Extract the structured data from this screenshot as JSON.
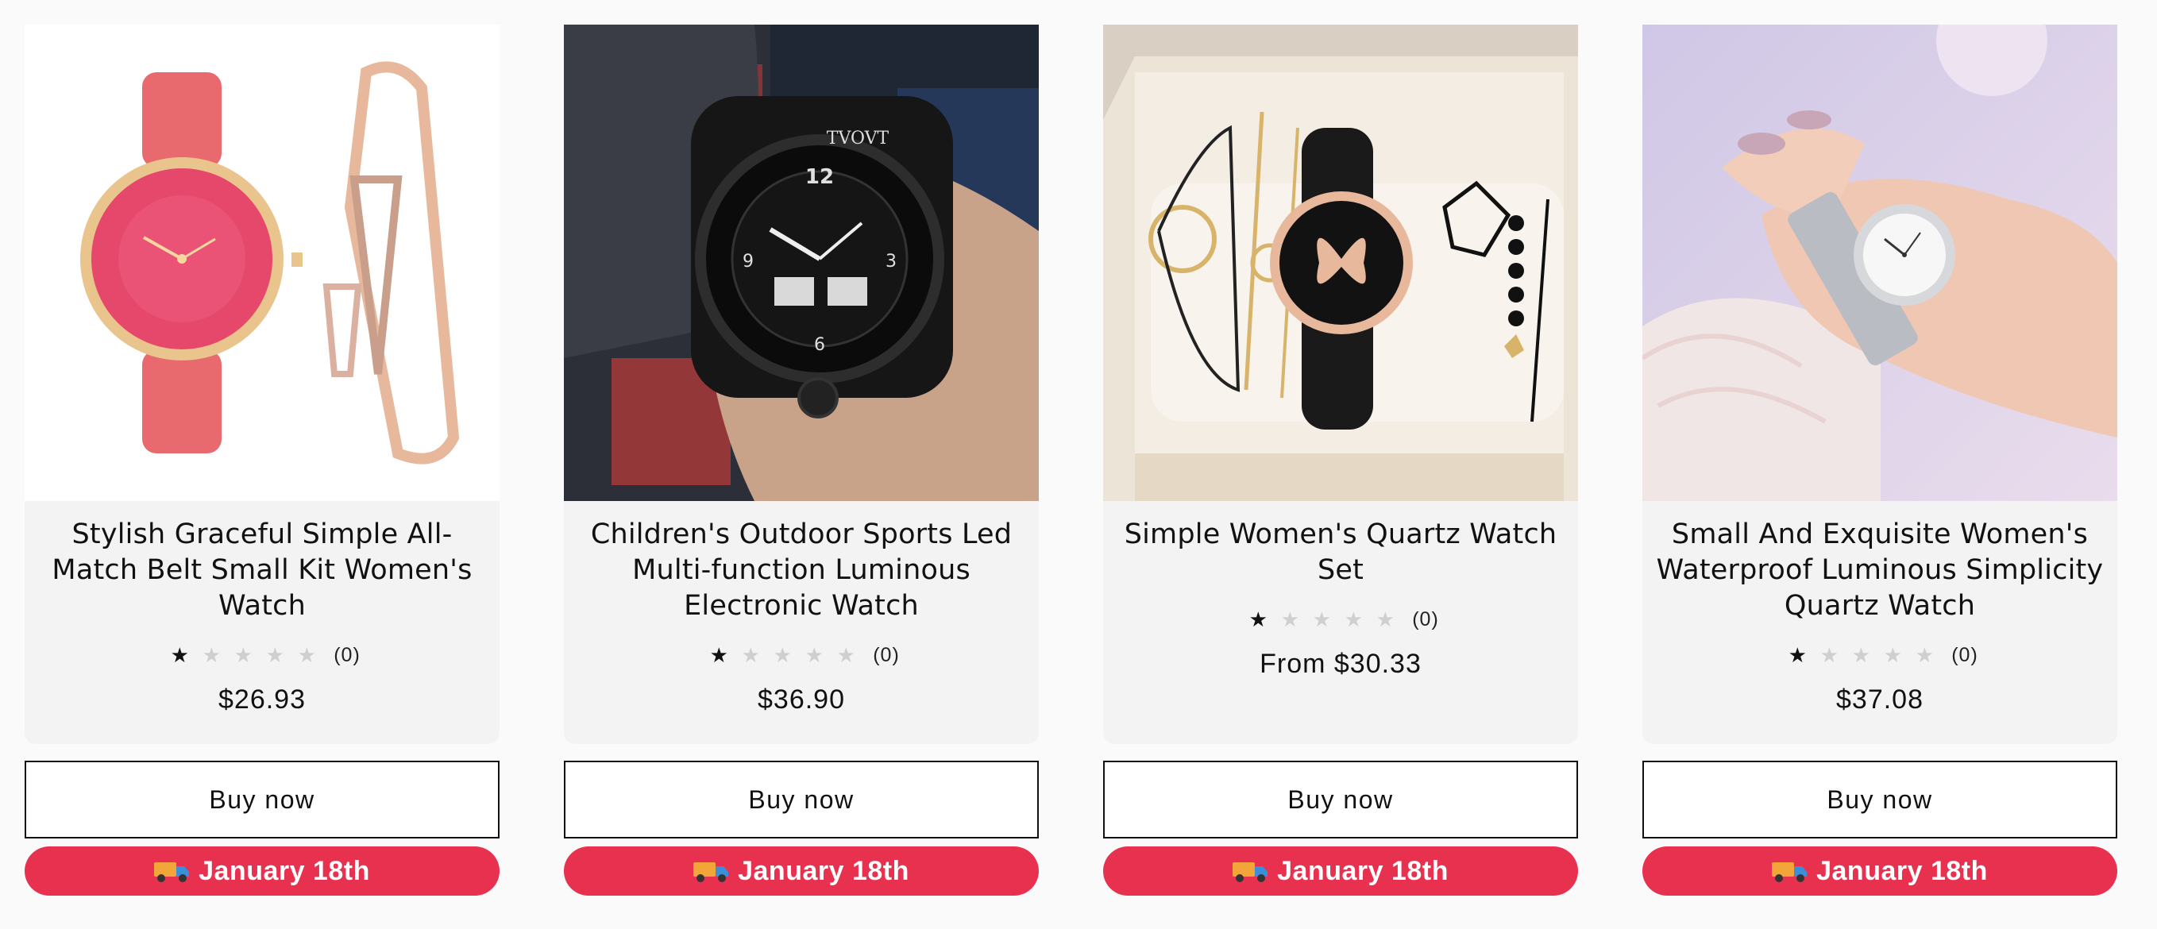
{
  "products": [
    {
      "title": "Stylish Graceful Simple All-Match Belt Small Kit Women's Watch",
      "stars_filled": 1,
      "stars_total": 5,
      "review_count": "(0)",
      "price": "$26.93",
      "buy_label": "Buy now",
      "delivery_label": "January 18th",
      "image": "pink-watch-and-bangle"
    },
    {
      "title": "Children's Outdoor Sports Led Multi-function Luminous Electronic Watch",
      "stars_filled": 1,
      "stars_total": 5,
      "review_count": "(0)",
      "price": "$36.90",
      "buy_label": "Buy now",
      "delivery_label": "January 18th",
      "image": "black-sports-watch",
      "brand_text": "TVOVT"
    },
    {
      "title": "Simple Women's Quartz Watch Set",
      "stars_filled": 1,
      "stars_total": 5,
      "review_count": "(0)",
      "price": "From $30.33",
      "buy_label": "Buy now",
      "delivery_label": "January 18th",
      "image": "butterfly-watch-bracelet-set"
    },
    {
      "title": "Small And Exquisite Women's Waterproof Luminous Simplicity Quartz Watch",
      "stars_filled": 1,
      "stars_total": 5,
      "review_count": "(0)",
      "price": "$37.08",
      "buy_label": "Buy now",
      "delivery_label": "January 18th",
      "image": "silver-watch-on-wrist"
    }
  ],
  "colors": {
    "delivery_bg": "#e8304f",
    "card_info_bg": "#f3f3f3",
    "page_bg": "#fafafa"
  },
  "icons": {
    "delivery": "truck-icon",
    "rating": "star-icon"
  }
}
